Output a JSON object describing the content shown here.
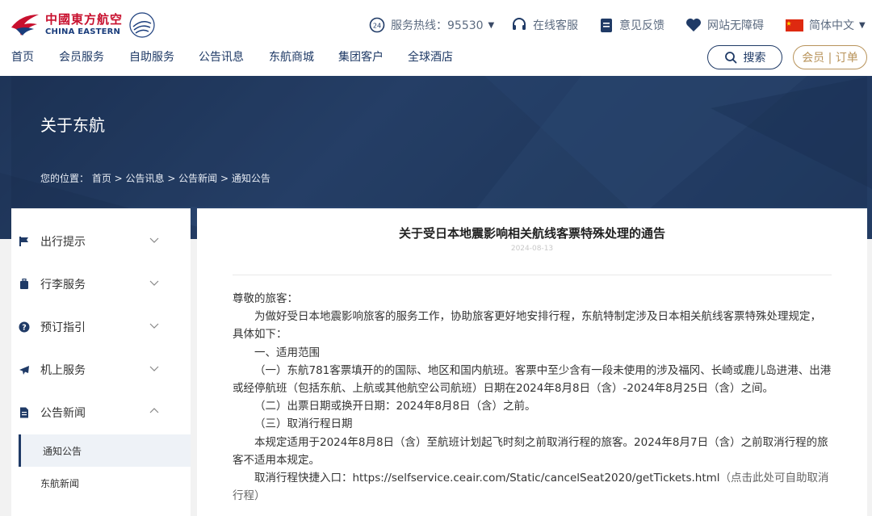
{
  "header": {
    "logo_cn": "中國東方航空",
    "logo_en": "CHINA EASTERN",
    "hotline_label": "服务热线：95530",
    "online_service": "在线客服",
    "feedback": "意见反馈",
    "accessibility": "网站无障碍",
    "language": "简体中文"
  },
  "nav": {
    "items": [
      "首页",
      "会员服务",
      "自助服务",
      "公告讯息",
      "东航商城",
      "集团客户",
      "全球酒店"
    ],
    "search_label": "搜索",
    "member_label": "会员 | 订单"
  },
  "banner": {
    "title": "关于东航",
    "breadcrumb": "您的位置： 首页 > 公告讯息 > 公告新闻 > 通知公告"
  },
  "sidebar": {
    "items": [
      {
        "label": "出行提示",
        "icon": "flag-icon"
      },
      {
        "label": "行李服务",
        "icon": "luggage-icon"
      },
      {
        "label": "预订指引",
        "icon": "question-icon"
      },
      {
        "label": "机上服务",
        "icon": "plane-icon"
      },
      {
        "label": "公告新闻",
        "icon": "document-icon"
      }
    ],
    "sub_items": [
      "通知公告",
      "东航新闻"
    ]
  },
  "article": {
    "title": "关于受日本地震影响相关航线客票特殊处理的通告",
    "date": "2024-08-13",
    "greeting": "尊敬的旅客：",
    "intro": "为做好受日本地震影响旅客的服务工作，协助旅客更好地安排行程，东航特制定涉及日本相关航线客票特殊处理规定，具体如下：",
    "section1": "一、适用范围",
    "item1": "（一）东航781客票填开的的国际、地区和国内航班。客票中至少含有一段未使用的涉及福冈、长崎或鹿儿岛进港、出港或经停航班（包括东航、上航或其他航空公司航班）日期在2024年8月8日（含）-2024年8月25日（含）之间。",
    "item2": "（二）出票日期或换开日期：2024年8月8日（含）之前。",
    "item3": "（三）取消行程日期",
    "rule": "本规定适用于2024年8月8日（含）至航班计划起飞时刻之前取消行程的旅客。2024年8月7日（含）之前取消行程的旅客不适用本规定。",
    "entry_label": "取消行程快捷入口：",
    "entry_url": "https://selfservice.ceair.com/Static/cancelSeat2020/getTickets.html",
    "entry_hint": "（点击此处可自助取消行程）"
  },
  "colors": {
    "brand_red": "#c8102e",
    "navy": "#1f3a66",
    "gold": "#b8935a",
    "banner": "#233d63"
  }
}
